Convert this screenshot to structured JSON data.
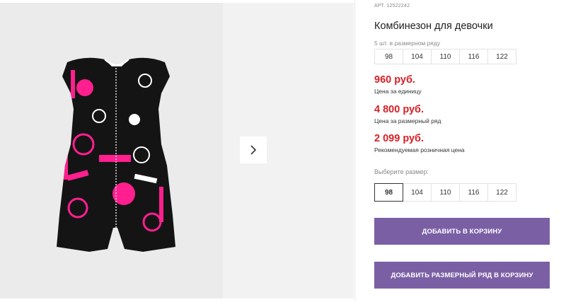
{
  "product": {
    "sku": "АРТ. 12522242",
    "title": "Комбинезон для девочки",
    "image_description_icon": "romper-photo"
  },
  "size_row": {
    "caption": "5 шт. в размерном ряду",
    "sizes": [
      "98",
      "104",
      "110",
      "116",
      "122"
    ]
  },
  "prices": [
    {
      "value": "960 руб.",
      "label": "Цена за единицу"
    },
    {
      "value": "4 800 руб.",
      "label": "Цена за размерный ряд"
    },
    {
      "value": "2 099 руб.",
      "label": "Рекомендуемая розничная цена"
    }
  ],
  "size_select": {
    "label": "Выберите размер:",
    "sizes": [
      "98",
      "104",
      "110",
      "116",
      "122"
    ],
    "selected": "98"
  },
  "buttons": {
    "add_to_cart": "ДОБАВИТЬ В КОРЗИНУ",
    "add_size_row": "ДОБАВИТЬ РАЗМЕРНЫЙ РЯД В КОРЗИНУ"
  },
  "gallery": {
    "next_icon": "chevron-right-icon"
  },
  "colors": {
    "price": "#d81f26",
    "button": "#7b5fa5",
    "print_pink": "#ff1f8e"
  }
}
